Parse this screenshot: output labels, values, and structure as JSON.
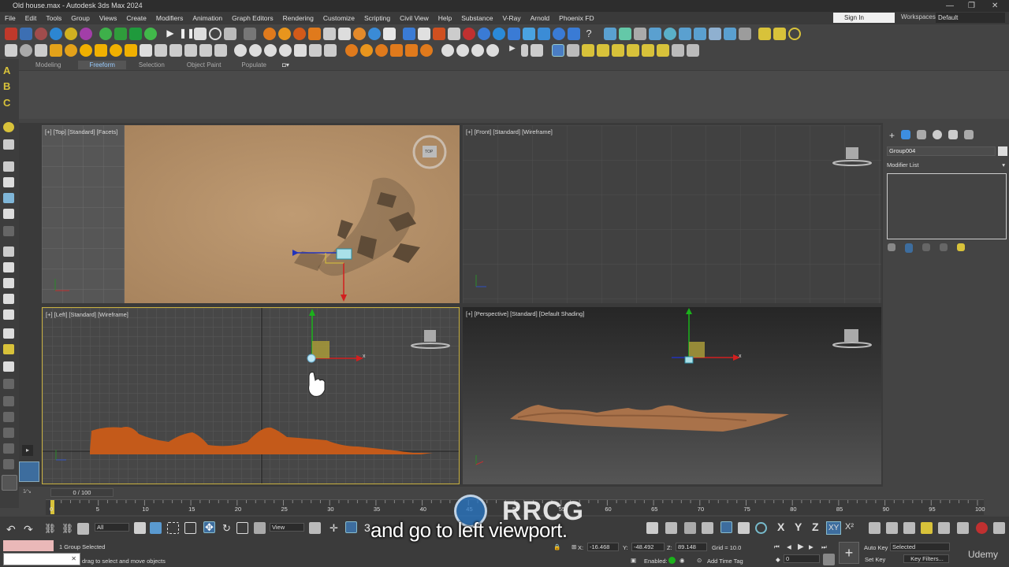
{
  "window": {
    "title": "Old house.max - Autodesk 3ds Max 2024"
  },
  "menu": [
    "File",
    "Edit",
    "Tools",
    "Group",
    "Views",
    "Create",
    "Modifiers",
    "Animation",
    "Graph Editors",
    "Rendering",
    "Customize",
    "Scripting",
    "Civil View",
    "Help",
    "Substance",
    "V-Ray",
    "Arnold",
    "Phoenix FD"
  ],
  "account": {
    "signin_label": "Sign In",
    "workspaces_label": "Workspaces:",
    "workspace_value": "Default"
  },
  "ribbon_tabs": [
    "Modeling",
    "Freeform",
    "Selection",
    "Object Paint",
    "Populate"
  ],
  "left_tools": {
    "a": "A",
    "b": "B",
    "c": "C"
  },
  "viewports": {
    "top": {
      "label": "[+] [Top] [Standard] [Facets]",
      "cube": "TOP"
    },
    "front": {
      "label": "[+] [Front] [Standard] [Wireframe]"
    },
    "left": {
      "label": "[+] [Left] [Standard] [Wireframe]"
    },
    "perspective": {
      "label": "[+] [Perspective] [Standard] [Default Shading]"
    }
  },
  "command_panel": {
    "object_name": "Group004",
    "modifier_list": "Modifier List"
  },
  "timeline": {
    "frame_slider": "0 / 100",
    "ticks": [
      "0",
      "5",
      "10",
      "15",
      "20",
      "25",
      "30",
      "35",
      "40",
      "45",
      "50",
      "55",
      "60",
      "65",
      "70",
      "75",
      "80",
      "85",
      "90",
      "95",
      "100"
    ]
  },
  "status": {
    "selection": "1 Group Selected",
    "prompt": "drag to select and move objects",
    "filter": "All",
    "view": "View",
    "x_label": "X:",
    "x_value": "-16.468",
    "y_label": "Y:",
    "y_value": "-48.492",
    "z_label": "Z:",
    "z_value": "89.148",
    "grid": "Grid = 10.0",
    "enabled": "Enabled:",
    "add_time_tag": "Add Time Tag",
    "auto_key": "Auto Key",
    "set_key": "Set Key",
    "selected": "Selected",
    "key_filters": "Key Filters...",
    "frame_value": "0",
    "axis_x": "X",
    "axis_y": "Y",
    "axis_z": "Z",
    "axis_xy": "XY",
    "snap3": "3"
  },
  "overlay": {
    "subtitle": "and go to left viewport.",
    "watermark": "RRCG",
    "udemy": "Udemy"
  },
  "colors": {
    "accent_blue": "#3d8ee0",
    "gizmo_red": "#d21f1f",
    "gizmo_green": "#1bb21b",
    "terrain_orange": "#c45a1a",
    "top_sand": "#b6926c"
  }
}
